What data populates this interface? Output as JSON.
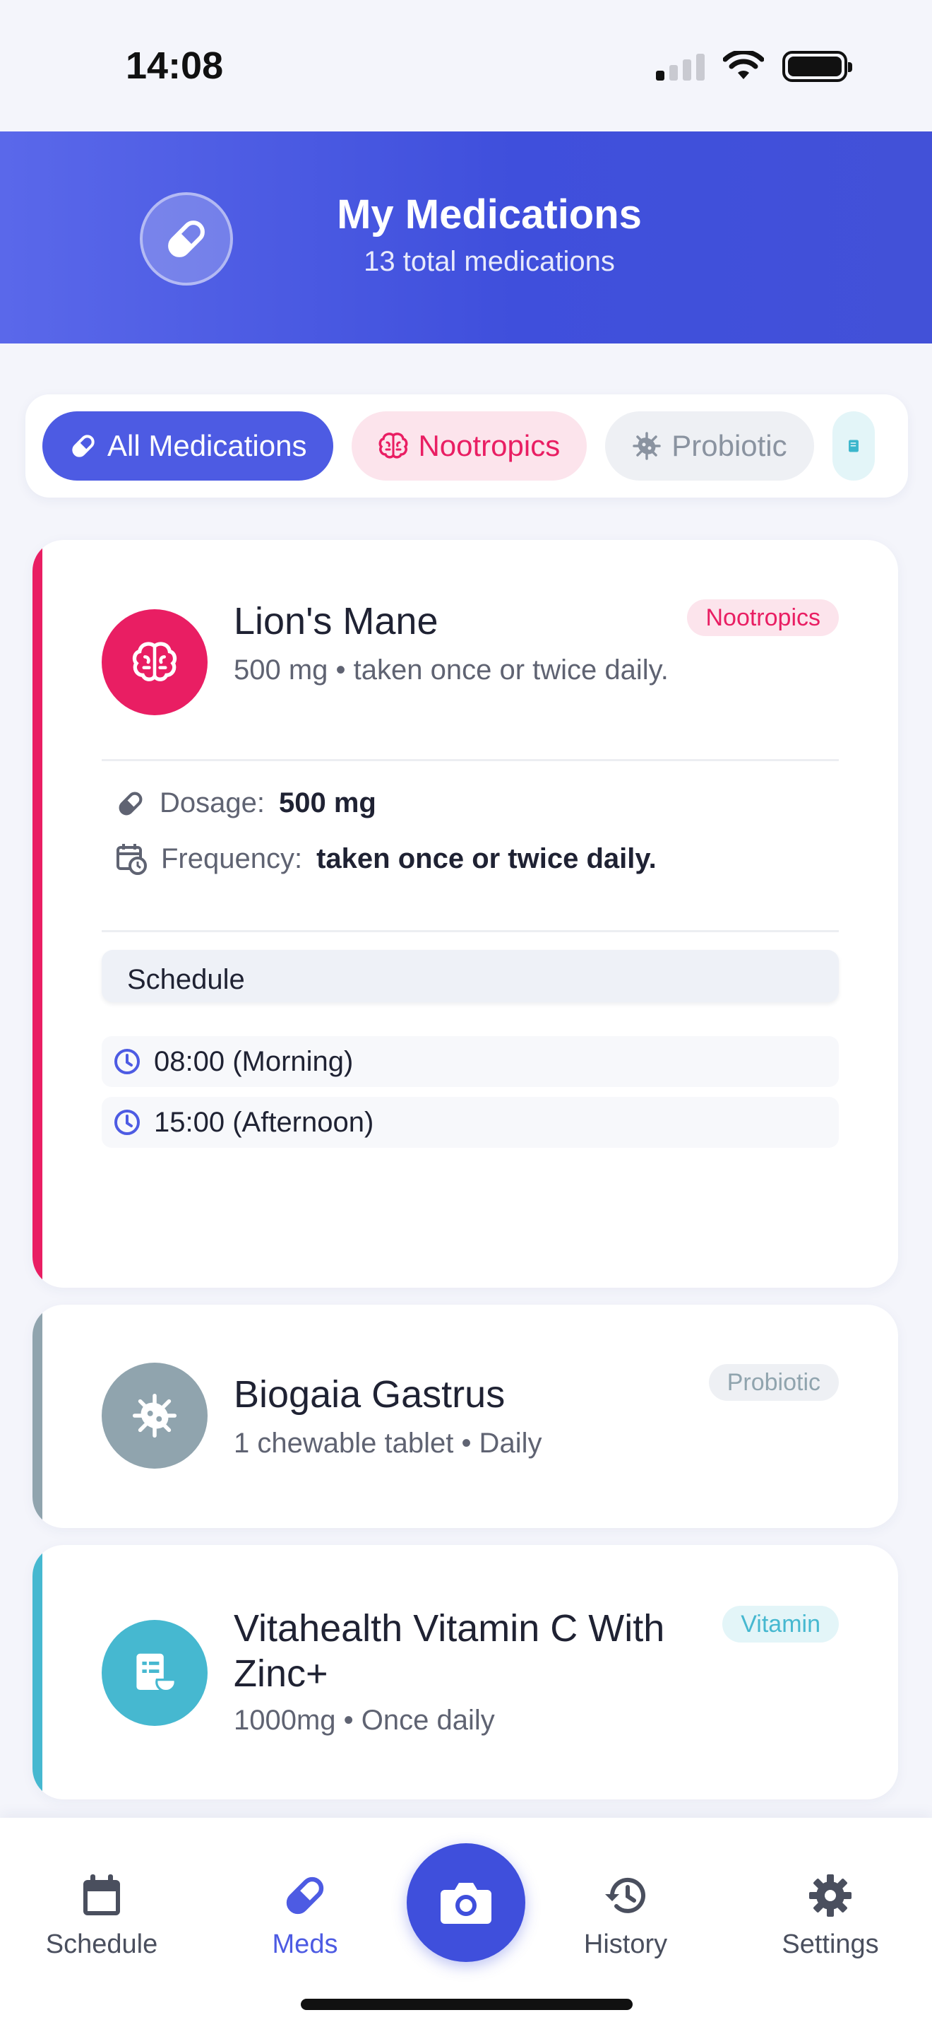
{
  "status_bar": {
    "time": "14:08"
  },
  "header": {
    "title": "My Medications",
    "subtitle": "13 total medications"
  },
  "filters": [
    {
      "label": "All Medications",
      "active": true
    },
    {
      "label": "Nootropics"
    },
    {
      "label": "Probiotic"
    }
  ],
  "medications": [
    {
      "name": "Lion's Mane",
      "summary": "500 mg • taken once or twice daily.",
      "category": "Nootropics",
      "color": "#e91e63",
      "dosage_label": "Dosage:",
      "dosage": "500 mg",
      "frequency_label": "Frequency:",
      "frequency": "taken once or twice daily.",
      "schedule_title": "Schedule",
      "times": [
        "08:00 (Morning)",
        "15:00 (Afternoon)"
      ]
    },
    {
      "name": "Biogaia Gastrus",
      "summary": "1 chewable tablet • Daily",
      "category": "Probiotic",
      "color": "#90a4ae"
    },
    {
      "name": "Vitahealth Vitamin C With Zinc+",
      "summary": "1000mg • Once daily",
      "category": "Vitamin",
      "color": "#46b8d0"
    }
  ],
  "nav": {
    "schedule": "Schedule",
    "meds": "Meds",
    "history": "History",
    "settings": "Settings"
  }
}
